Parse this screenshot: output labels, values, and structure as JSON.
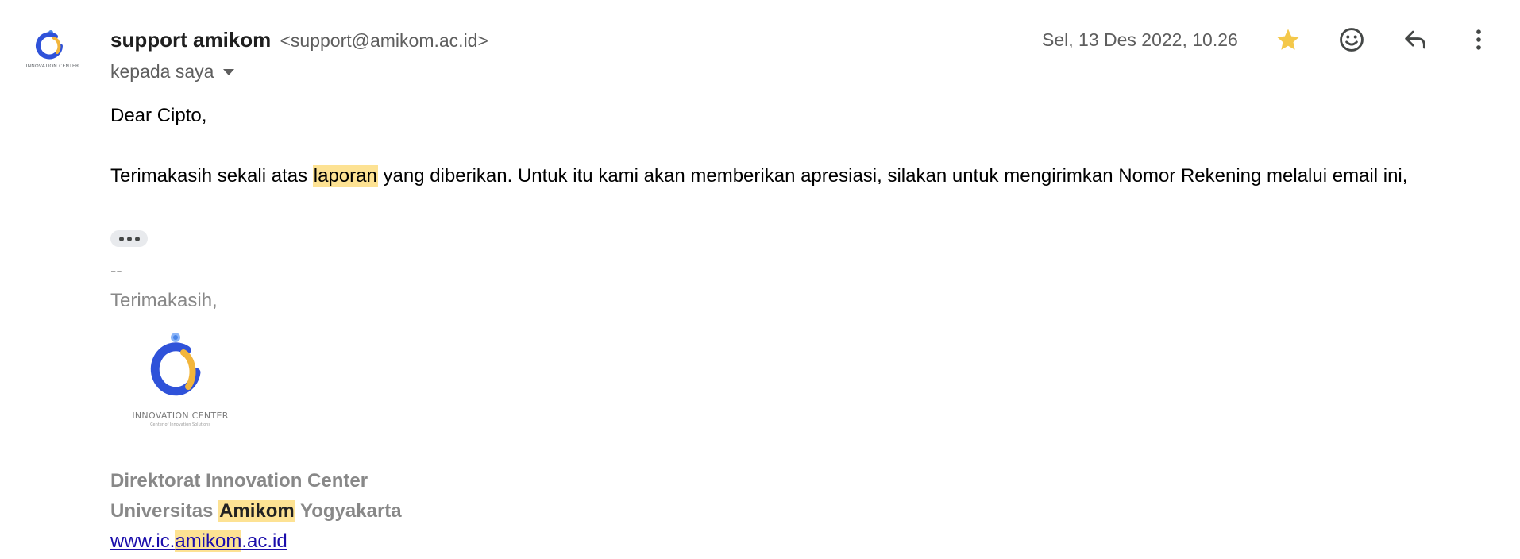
{
  "sender": {
    "name": "support amikom",
    "email": "<support@amikom.ac.id>",
    "recipient_label": "kepada saya",
    "avatar_caption": "INNOVATION CENTER"
  },
  "header": {
    "date": "Sel, 13 Des 2022, 10.26",
    "icons": [
      "star-icon",
      "emoji-icon",
      "reply-icon",
      "more-vert-icon"
    ],
    "star_color": "#f4c84a"
  },
  "message": {
    "greeting": "Dear Cipto,",
    "paragraph_before": "Terimakasih sekali atas ",
    "paragraph_highlight": "laporan",
    "paragraph_after": " yang diberikan. Untuk itu kami akan memberikan apresiasi, silakan untuk mengirimkan Nomor Rekening melalui email ini,",
    "highlight_color": "#fde293"
  },
  "signature": {
    "dash": "--",
    "thanks": "Terimakasih,",
    "logo_caption": "INNOVATION CENTER",
    "logo_subcaption": "Center of Innovation Solutions",
    "org": "Direktorat Innovation Center",
    "univ_before": "Universitas ",
    "univ_highlight": "Amikom",
    "univ_after": " Yogyakarta",
    "link_before": "www.ic.",
    "link_highlight": "amikom",
    "link_after": ".ac.id"
  }
}
